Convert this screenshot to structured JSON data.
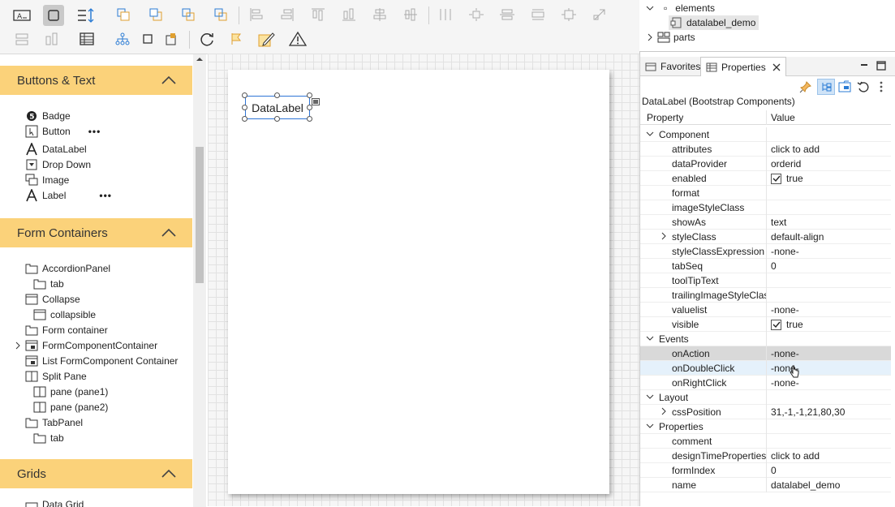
{
  "palette": {
    "sections": [
      {
        "title": "Buttons & Text",
        "items": [
          {
            "label": "Badge",
            "icon": "badge-icon"
          },
          {
            "label": "Button",
            "icon": "button-icon",
            "more": "•••"
          },
          {
            "label": "DataLabel",
            "icon": "text-a-icon"
          },
          {
            "label": "Drop Down",
            "icon": "dropdown-icon"
          },
          {
            "label": "Image",
            "icon": "image-icon"
          },
          {
            "label": "Label",
            "icon": "text-a-icon",
            "more": "•••"
          }
        ]
      },
      {
        "title": "Form Containers",
        "items": [
          {
            "label": "AccordionPanel",
            "icon": "folder-icon"
          },
          {
            "label": "tab",
            "icon": "folder-icon"
          },
          {
            "label": "Collapse",
            "icon": "window-icon"
          },
          {
            "label": "collapsible",
            "icon": "window-icon"
          },
          {
            "label": "Form container",
            "icon": "folder-icon"
          },
          {
            "label": "FormComponentContainer",
            "icon": "window-icon"
          },
          {
            "label": "List FormComponent Container",
            "icon": "window-icon"
          },
          {
            "label": "Split Pane",
            "icon": "split-icon"
          },
          {
            "label": "pane (pane1)",
            "icon": "split-icon"
          },
          {
            "label": "pane (pane2)",
            "icon": "split-icon"
          },
          {
            "label": "TabPanel",
            "icon": "folder-icon"
          },
          {
            "label": "tab",
            "icon": "folder-icon"
          }
        ]
      },
      {
        "title": "Grids",
        "items": [
          {
            "label": "Data Grid",
            "icon": "grid-icon"
          }
        ]
      }
    ]
  },
  "canvas": {
    "component_label": "DataLabel"
  },
  "outline": {
    "elements_label": "elements",
    "selected_label": "datalabel_demo",
    "parts_label": "parts"
  },
  "tabs": {
    "favorites": "Favorites",
    "properties": "Properties"
  },
  "properties": {
    "title": "DataLabel (Bootstrap Components)",
    "col_property": "Property",
    "col_value": "Value",
    "rows": [
      {
        "name": "Component",
        "value": "",
        "level": 0,
        "expander": "open"
      },
      {
        "name": "attributes",
        "value": "click to add",
        "level": 1
      },
      {
        "name": "dataProvider",
        "value": "orderid",
        "level": 1
      },
      {
        "name": "enabled",
        "value": "true",
        "level": 1,
        "checked": true
      },
      {
        "name": "format",
        "value": "",
        "level": 1
      },
      {
        "name": "imageStyleClass",
        "value": "",
        "level": 1
      },
      {
        "name": "showAs",
        "value": "text",
        "level": 1
      },
      {
        "name": "styleClass",
        "value": "default-align",
        "level": 1,
        "expander": "closed"
      },
      {
        "name": "styleClassExpression",
        "value": "-none-",
        "level": 1
      },
      {
        "name": "tabSeq",
        "value": "0",
        "level": 1
      },
      {
        "name": "toolTipText",
        "value": "",
        "level": 1
      },
      {
        "name": "trailingImageStyleClas",
        "value": "",
        "level": 1
      },
      {
        "name": "valuelist",
        "value": "-none-",
        "level": 1
      },
      {
        "name": "visible",
        "value": "true",
        "level": 1,
        "checked": true
      },
      {
        "name": "Events",
        "value": "",
        "level": 0,
        "expander": "open"
      },
      {
        "name": "onAction",
        "value": "-none-",
        "level": 1,
        "state": "selected"
      },
      {
        "name": "onDoubleClick",
        "value": "-none-",
        "level": 1,
        "state": "hover"
      },
      {
        "name": "onRightClick",
        "value": "-none-",
        "level": 1
      },
      {
        "name": "Layout",
        "value": "",
        "level": 0,
        "expander": "open"
      },
      {
        "name": "cssPosition",
        "value": "31,-1,-1,21,80,30",
        "level": 1,
        "expander": "closed"
      },
      {
        "name": "Properties",
        "value": "",
        "level": 0,
        "expander": "open"
      },
      {
        "name": "comment",
        "value": "",
        "level": 1
      },
      {
        "name": "designTimeProperties",
        "value": "click to add",
        "level": 1
      },
      {
        "name": "formIndex",
        "value": "0",
        "level": 1
      },
      {
        "name": "name",
        "value": "datalabel_demo",
        "level": 1
      }
    ]
  },
  "colors": {
    "palette_header": "#fbd27a",
    "selection_blue": "#2f75d6",
    "row_selected": "#d9d9d9",
    "row_hover": "#e5f1fb"
  }
}
